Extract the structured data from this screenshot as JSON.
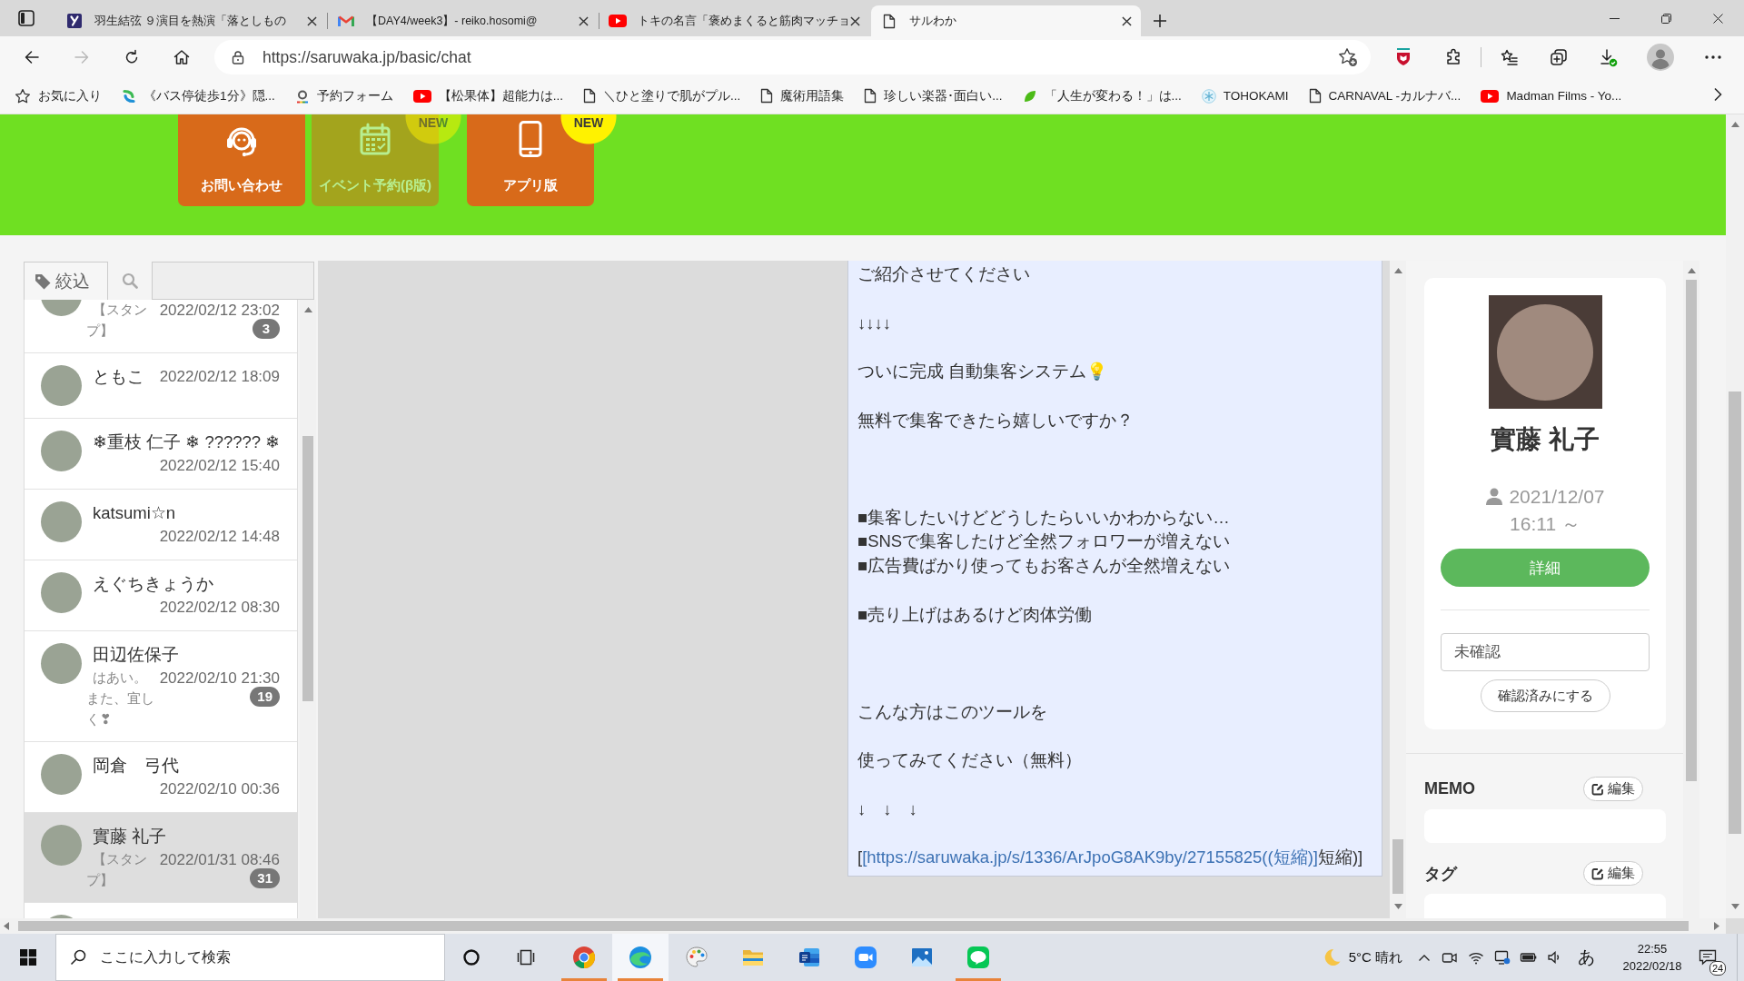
{
  "browser": {
    "tabs": [
      {
        "kind": "site",
        "title": "羽生結弦 ９演目を熱演「落としもの",
        "selected": false
      },
      {
        "kind": "mail",
        "title": "【DAY4/week3】- reiko.hosomi@",
        "selected": false
      },
      {
        "kind": "video",
        "title": "トキの名言「褒めまくると筋肉マッチョ",
        "selected": false
      },
      {
        "kind": "page",
        "title": "サルわか",
        "selected": true
      }
    ],
    "url": "https://saruwaka.jp/basic/chat",
    "bookmarks": [
      {
        "kind": "star",
        "label": "お気に入り"
      },
      {
        "kind": "swirl",
        "label": "《バス停徒歩1分》隠..."
      },
      {
        "kind": "ring",
        "label": "予約フォーム"
      },
      {
        "kind": "video",
        "label": "【松果体】超能力は..."
      },
      {
        "kind": "page",
        "label": "＼ひと塗りで肌がプル..."
      },
      {
        "kind": "page",
        "label": "魔術用語集"
      },
      {
        "kind": "page",
        "label": "珍しい楽器･面白い..."
      },
      {
        "kind": "leaf",
        "label": "「人生が変わる！」は..."
      },
      {
        "kind": "snowflake",
        "label": "TOHOKAMI"
      },
      {
        "kind": "page",
        "label": "CARNAVAL -カルナバ..."
      },
      {
        "kind": "video",
        "label": "Madman Films - Yo..."
      }
    ]
  },
  "header": {
    "buttons": [
      {
        "kind": "headset",
        "label": "お問い合わせ",
        "disabled": false
      },
      {
        "kind": "calendar",
        "label": "イベント予約(β版)",
        "disabled": true,
        "badge": "NEW"
      },
      {
        "kind": "phone",
        "label": "アプリ版",
        "disabled": false,
        "badge": "NEW"
      }
    ]
  },
  "contacts": {
    "filter_label": "絞込",
    "rows": [
      {
        "preview": "【スタンプ】",
        "time": "2022/02/12 23:02",
        "unread": "3",
        "selected": false
      },
      {
        "name": "ともこ",
        "time": "2022/02/12 18:09",
        "selected": false
      },
      {
        "name": "❄重枝 仁子 ❄ ?????? ❄",
        "time": "2022/02/12 15:40",
        "selected": false
      },
      {
        "name": "katsumi☆n",
        "time": "2022/02/12 14:48",
        "selected": false
      },
      {
        "name": "えぐちきょうか",
        "time": "2022/02/12 08:30",
        "selected": false
      },
      {
        "name": "田辺佐保子",
        "preview": "はあい。また、宜しく❣",
        "time": "2022/02/10 21:30",
        "unread": "19",
        "selected": false
      },
      {
        "name": "岡倉　弓代",
        "time": "2022/02/10 00:36",
        "selected": false
      },
      {
        "name": "實藤 礼子",
        "preview": "【スタンプ】",
        "time": "2022/01/31 08:46",
        "unread": "31",
        "selected": true
      },
      {
        "selected": false
      }
    ]
  },
  "chat": {
    "message": {
      "sections": [
        {
          "paragraphs": [
            [
              {
                "text": "ご紹介させてください"
              }
            ],
            [
              {
                "text": "↓↓↓↓"
              }
            ],
            [
              {
                "text": "ついに完成 自動集客システム💡"
              }
            ],
            [
              {
                "text": "無料で集客できたら嬉しいですか？"
              }
            ]
          ]
        },
        {
          "paragraphs": [
            [
              {
                "text": "■集客したいけどどうしたらいいかわからない…"
              },
              {
                "text": "■SNSで集客したけど全然フォロワーが増えない"
              },
              {
                "text": "■広告費ばかり使ってもお客さんが全然増えない"
              }
            ],
            [
              {
                "text": "■売り上げはあるけど肉体労働"
              }
            ]
          ]
        },
        {
          "paragraphs": [
            [
              {
                "text": "こんな方はこのツールを"
              }
            ],
            [
              {
                "text": "使ってみてください（無料）"
              }
            ],
            [
              {
                "text": "↓　↓　↓"
              }
            ],
            [
              {
                "text": "[",
                "link": "[https://saruwaka.jp/s/1336/ArJpoG8AK9by/27155825((短縮)]",
                "text_after": "短縮)]"
              }
            ]
          ]
        }
      ]
    }
  },
  "profile": {
    "name": "實藤 礼子",
    "since": "2021/12/07 16:11 ～",
    "detail_button": "詳細",
    "status": "未確認",
    "confirm_button": "確認済みにする"
  },
  "memo": {
    "title": "MEMO",
    "edit_button": "編集"
  },
  "tags": {
    "title": "タグ",
    "edit_button": "編集"
  },
  "taskbar": {
    "search": {
      "placeholder": "ここに入力して検索"
    },
    "apps": [
      {
        "kind": "chrome",
        "running": true,
        "selected": false
      },
      {
        "kind": "edge",
        "running": true,
        "selected": true
      },
      {
        "kind": "paint",
        "running": false,
        "selected": false
      },
      {
        "kind": "explorer",
        "running": false,
        "selected": false
      },
      {
        "kind": "word",
        "running": false,
        "selected": false
      },
      {
        "kind": "zoom",
        "running": false,
        "selected": false
      },
      {
        "kind": "photos",
        "running": false,
        "selected": false
      },
      {
        "kind": "line",
        "running": true,
        "selected": false
      }
    ],
    "weather": "5°C 晴れ",
    "ime": "あ",
    "time": "22:55",
    "date": "2022/02/18",
    "notifications": "24"
  }
}
